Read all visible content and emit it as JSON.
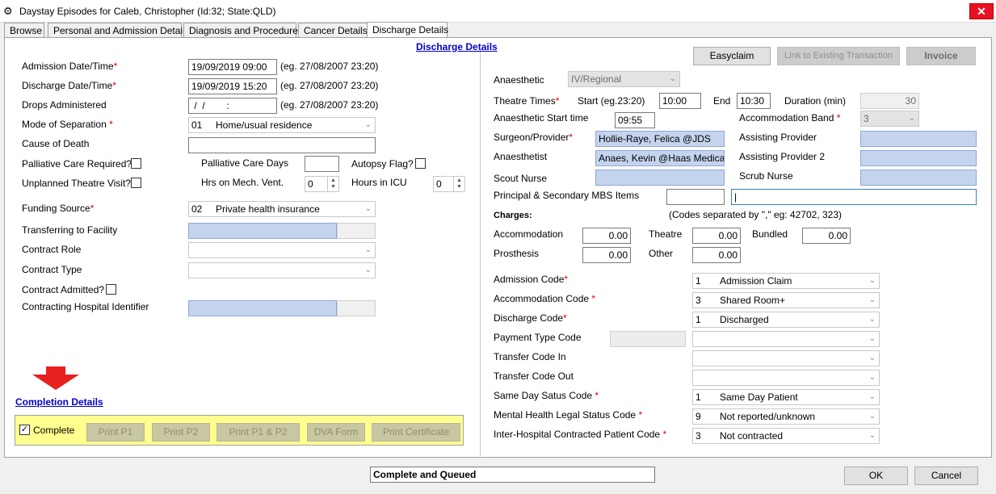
{
  "window": {
    "title": "Daystay Episodes for Caleb, Christopher (Id:32; State:QLD)",
    "close_glyph": "✕"
  },
  "tabs": [
    {
      "label": "Browse"
    },
    {
      "label": "Personal and Admission Details"
    },
    {
      "label": "Diagnosis and Procedures"
    },
    {
      "label": "Cancer Details"
    },
    {
      "label": "Discharge Details"
    }
  ],
  "section_title": "Discharge Details",
  "left": {
    "admission_label": "Admission Date/Time",
    "admission_value": "19/09/2019 09:00",
    "admission_hint": "(eg. 27/08/2007 23:20)",
    "discharge_label": "Discharge Date/Time",
    "discharge_value": "19/09/2019 15:20",
    "discharge_hint": "(eg. 27/08/2007 23:20)",
    "drops_label": "Drops Administered",
    "drops_value": " /  /        :",
    "drops_hint": "(eg. 27/08/2007 23:20)",
    "separation_label": "Mode of Separation",
    "separation_code": "01",
    "separation_value": "Home/usual residence",
    "cause_label": "Cause of Death",
    "cause_value": "",
    "palliative_label": "Palliative Care Required?",
    "palliative_days_label": "Palliative Care Days",
    "palliative_days_value": "",
    "autopsy_label": "Autopsy Flag?",
    "unplanned_label": "Unplanned Theatre Visit?",
    "mech_vent_label": "Hrs on Mech. Vent.",
    "mech_vent_value": "0",
    "icu_label": "Hours in ICU",
    "icu_value": "0",
    "funding_label": "Funding Source",
    "funding_code": "02",
    "funding_value": "Private health insurance",
    "transfer_facility_label": "Transferring to Facility",
    "contract_role_label": "Contract Role",
    "contract_type_label": "Contract Type",
    "contract_admitted_label": "Contract Admitted?",
    "contract_hospital_label": "Contracting Hospital Identifier"
  },
  "completion": {
    "title": "Completion Details",
    "complete_label": "Complete",
    "complete_checked": "✓",
    "buttons": [
      "Print P1",
      "Print P2",
      "Print P1 & P2",
      "DVA Form",
      "Print Certificate"
    ]
  },
  "right": {
    "top_buttons": {
      "easyclaim": "Easyclaim",
      "link": "Link to Existing Transaction",
      "invoice": "Invoice"
    },
    "anaesthetic_label": "Anaesthetic",
    "anaesthetic_value": "IV/Regional",
    "theatre_times_label": "Theatre Times",
    "start_label": "Start (eg.23:20)",
    "start_value": "10:00",
    "end_label": "End",
    "end_value": "10:30",
    "duration_label": "Duration (min)",
    "duration_value": "30",
    "anaes_start_label": "Anaesthetic Start time",
    "anaes_start_value": "09:55",
    "accom_band_label": "Accommodation Band",
    "accom_band_value": "3",
    "surgeon_label": "Surgeon/Provider",
    "surgeon_value": "Hollie-Raye, Felica @JDS",
    "assisting_label": "Assisting Provider",
    "anaesthetist_label": "Anaesthetist",
    "anaesthetist_value": "Anaes, Kevin @Haas Medical Ce",
    "assisting2_label": "Assisting Provider 2",
    "scout_label": "Scout Nurse",
    "scrub_label": "Scrub Nurse",
    "mbs_label": "Principal & Secondary MBS Items",
    "mbs_principal": "",
    "mbs_secondary": "|",
    "charges_label": "Charges:",
    "charges_hint": "(Codes separated by \",\" eg: 42702, 323)",
    "accommodation_label": "Accommodation",
    "accommodation_value": "0.00",
    "theatre_label": "Theatre",
    "theatre_value": "0.00",
    "bundled_label": "Bundled",
    "bundled_value": "0.00",
    "prosthesis_label": "Prosthesis",
    "prosthesis_value": "0.00",
    "other_label": "Other",
    "other_value": "0.00",
    "codes": [
      {
        "label": "Admission Code",
        "req": "*",
        "code": "1",
        "value": "Admission Claim"
      },
      {
        "label": "Accommodation Code",
        "req": "*",
        "code": "3",
        "value": "Shared Room+"
      },
      {
        "label": "Discharge Code",
        "req": "*",
        "code": "1",
        "value": "Discharged"
      },
      {
        "label": "Payment Type Code",
        "req": "",
        "code": "",
        "value": ""
      },
      {
        "label": "Transfer Code In",
        "req": "",
        "code": "",
        "value": ""
      },
      {
        "label": "Transfer Code Out",
        "req": "",
        "code": "",
        "value": ""
      },
      {
        "label": "Same Day Satus Code",
        "req": "*",
        "code": "1",
        "value": "Same Day Patient"
      },
      {
        "label": "Mental Health Legal Status Code",
        "req": "*",
        "code": "9",
        "value": "Not reported/unknown"
      },
      {
        "label": "Inter-Hospital Contracted Patient Code",
        "req": "*",
        "code": "3",
        "value": "Not contracted"
      }
    ]
  },
  "footer": {
    "status_value": "Complete and Queued",
    "ok_label": "OK",
    "cancel_label": "Cancel"
  },
  "required_marker": "*",
  "icons": {
    "dropdown": "chevron-down-icon",
    "arrow": "red-down-arrow-icon"
  },
  "colors": {
    "required": "#e00000",
    "link": "#0000cc",
    "highlight": "#ffff8f",
    "lookup_field": "#c5d4ee"
  }
}
